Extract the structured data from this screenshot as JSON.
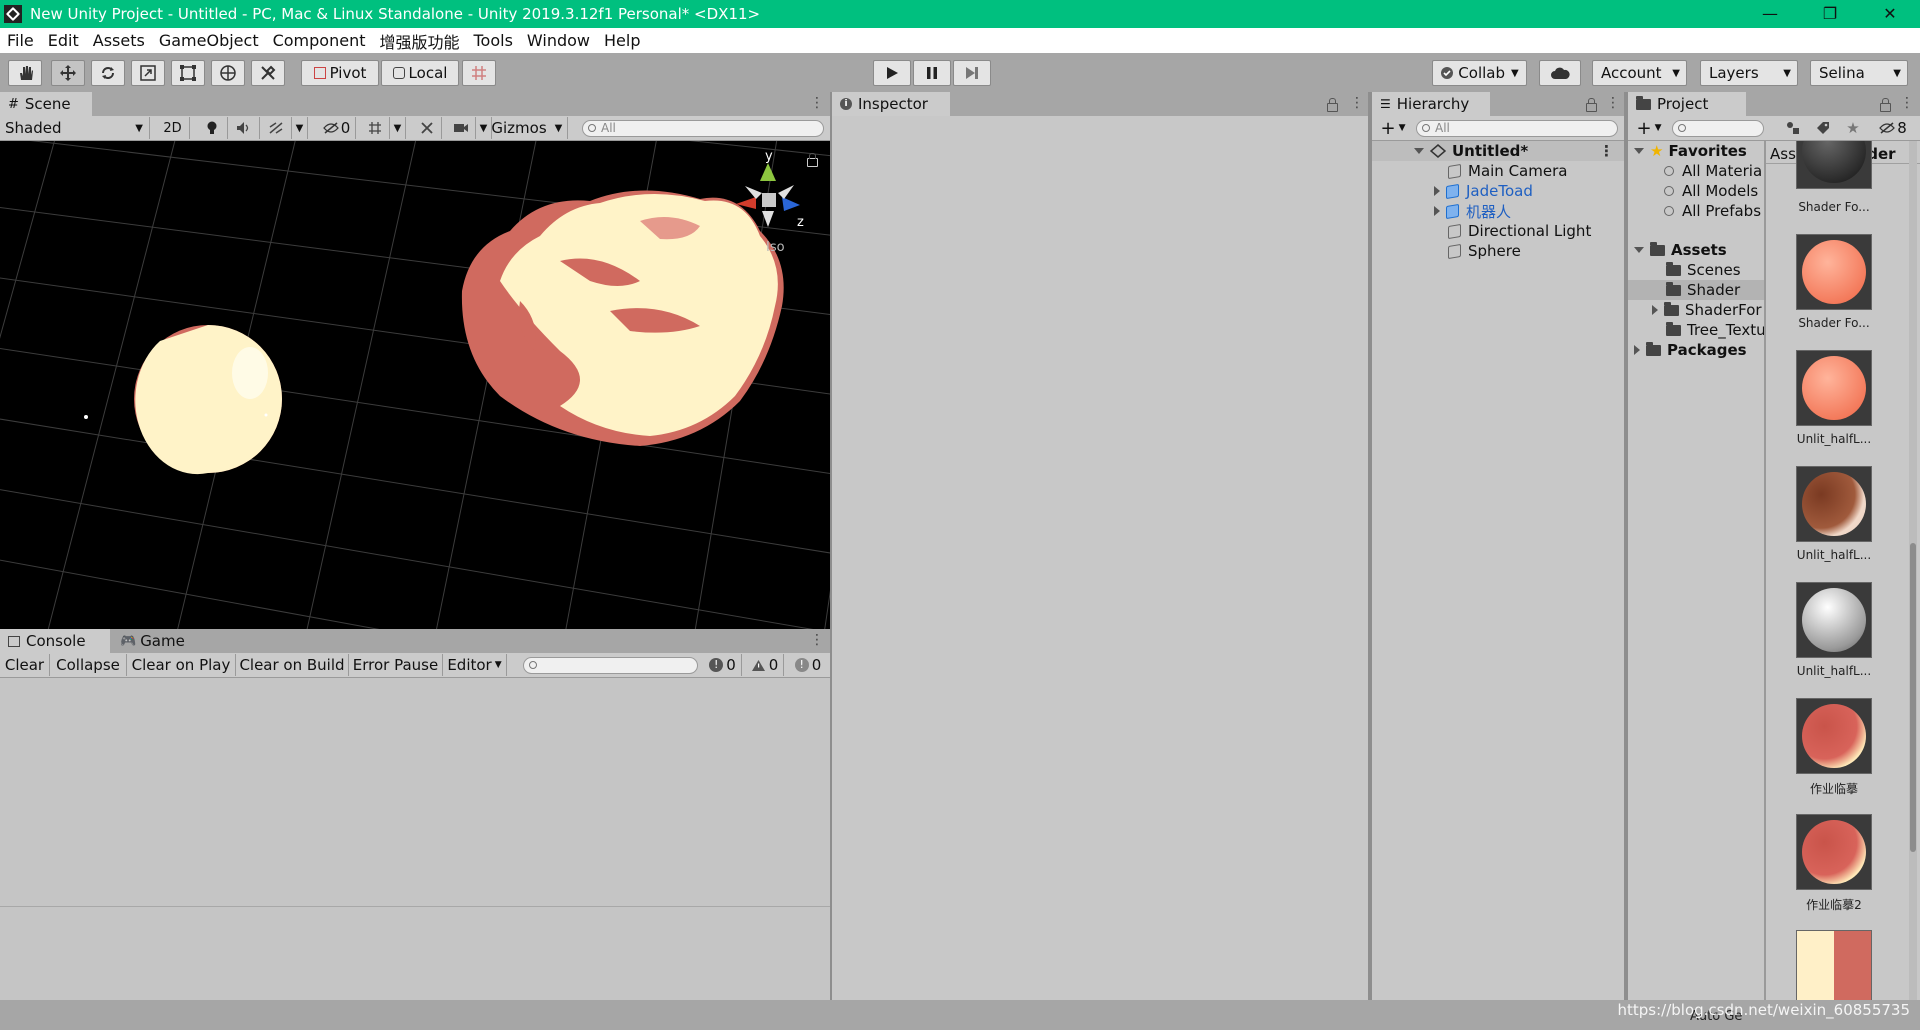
{
  "window": {
    "title": "New Unity Project - Untitled - PC, Mac & Linux Standalone - Unity 2019.3.12f1 Personal* <DX11>",
    "controls": [
      "—",
      "❐",
      "✕"
    ]
  },
  "menu": [
    "File",
    "Edit",
    "Assets",
    "GameObject",
    "Component",
    "增强版功能",
    "Tools",
    "Window",
    "Help"
  ],
  "toolbar": {
    "pivot": "Pivot",
    "local": "Local",
    "collab": "Collab",
    "account": "Account",
    "layers": "Layers",
    "user": "Selina"
  },
  "scene": {
    "tab": "Scene",
    "shading": "Shaded",
    "mode2d": "2D",
    "hidden_count": "0",
    "gizmos": "Gizmos",
    "search_placeholder": "All",
    "projection": "Iso",
    "axis_y": "y",
    "axis_z": "z"
  },
  "inspector": {
    "tab": "Inspector"
  },
  "hierarchy": {
    "tab": "Hierarchy",
    "search_placeholder": "All",
    "scene_name": "Untitled*",
    "items": [
      "Main Camera",
      "JadeToad",
      "机器人",
      "Directional Light",
      "Sphere"
    ]
  },
  "project": {
    "tab": "Project",
    "hidden_count": "8",
    "favorites": "Favorites",
    "favorite_items": [
      "All Materia",
      "All Models",
      "All Prefabs"
    ],
    "assets": "Assets",
    "asset_folders": [
      "Scenes",
      "Shader",
      "ShaderFor",
      "Tree_Textu"
    ],
    "packages": "Packages",
    "breadcrumb": [
      "Assets",
      "Shader"
    ],
    "thumbnails": [
      "Shader Fo...",
      "Shader Fo...",
      "Unlit_halfL...",
      "Unlit_halfL...",
      "Unlit_halfL...",
      "作业临摹",
      "作业临摹2"
    ]
  },
  "console": {
    "tabs": [
      "Console",
      "Game"
    ],
    "buttons": [
      "Clear",
      "Collapse",
      "Clear on Play",
      "Clear on Build",
      "Error Pause",
      "Editor"
    ],
    "counts": [
      "0",
      "0",
      "0"
    ]
  },
  "statusbar": {
    "watermark": "https://blog.csdn.net/weixin_60855735",
    "hint": "Auto Ge"
  }
}
